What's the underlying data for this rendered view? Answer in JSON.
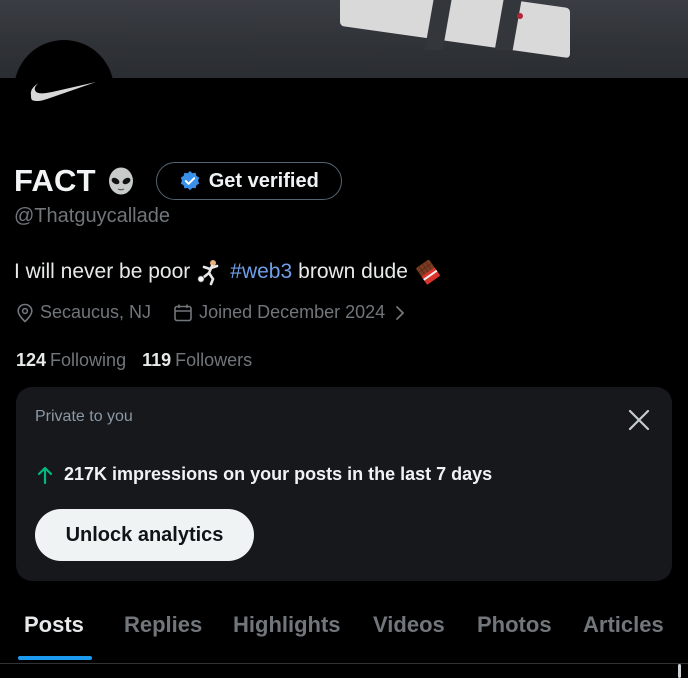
{
  "profile": {
    "display_name": "FACT",
    "name_emoji": "alien-emoji",
    "verify_button_label": "Get verified",
    "handle": "@Thatguycallade",
    "bio": {
      "part1": "I will never be poor",
      "emoji1": "soccer-player-emoji",
      "hashtag": "#web3",
      "part2": "brown dude",
      "emoji2": "chocolate-bar-emoji"
    },
    "location": "Secaucus, NJ",
    "joined": "Joined December 2024",
    "following_count": "124",
    "following_label": "Following",
    "followers_count": "119",
    "followers_label": "Followers"
  },
  "private_card": {
    "title": "Private to you",
    "impressions_text": "217K impressions on your posts in the last 7 days",
    "unlock_label": "Unlock analytics"
  },
  "tabs": [
    {
      "label": "Posts",
      "active": true
    },
    {
      "label": "Replies",
      "active": false
    },
    {
      "label": "Highlights",
      "active": false
    },
    {
      "label": "Videos",
      "active": false
    },
    {
      "label": "Photos",
      "active": false
    },
    {
      "label": "Articles",
      "active": false
    }
  ],
  "colors": {
    "background": "#000000",
    "accent": "#1d9bf0",
    "hashtag": "#6f9fe8",
    "verified_badge": "#3a8fe8",
    "impressions_arrow": "#00ba7c",
    "card_bg": "#16181c"
  }
}
